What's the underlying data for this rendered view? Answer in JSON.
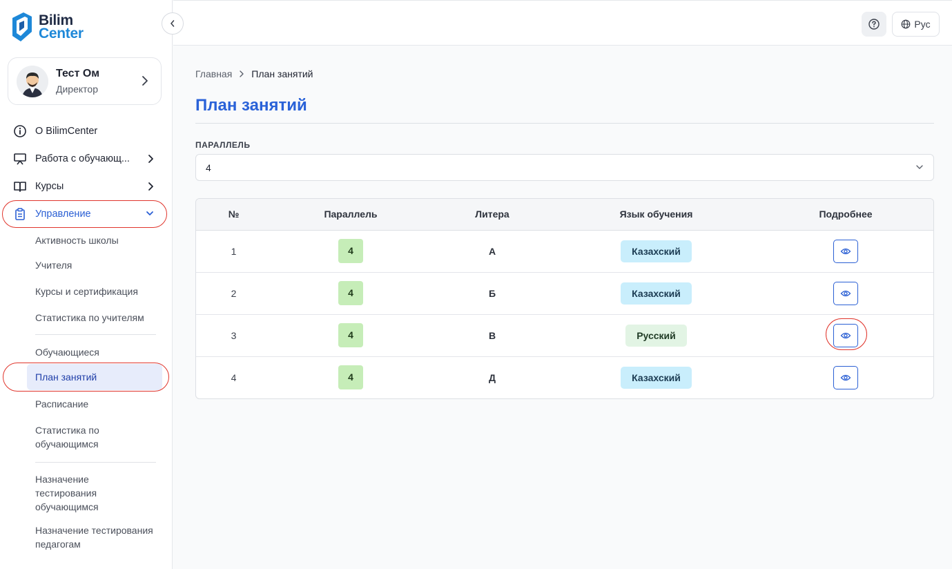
{
  "logo": {
    "line1": "Bilim",
    "line2": "Center"
  },
  "profile": {
    "name": "Тест Ом",
    "role": "Директор"
  },
  "nav": {
    "about": "О BilimCenter",
    "students_work": "Работа с обучающ...",
    "courses": "Курсы",
    "management": "Управление"
  },
  "submenu": {
    "activity": "Активность школы",
    "teachers": "Учителя",
    "courses_cert": "Курсы и сертификация",
    "teacher_stats": "Статистика по учителям",
    "students": "Обучающиеся",
    "lesson_plan": "План занятий",
    "schedule": "Расписание",
    "student_stats": "Статистика по обучающимся",
    "assign_student_tests": "Назначение тестирования обучающимся",
    "assign_teacher_tests": "Назначение тестирования педагогам"
  },
  "topbar": {
    "language": "Рус"
  },
  "breadcrumb": {
    "home": "Главная",
    "current": "План занятий"
  },
  "page": {
    "title": "План занятий"
  },
  "filter": {
    "label": "ПАРАЛЛЕЛЬ",
    "value": "4"
  },
  "table": {
    "headers": {
      "num": "№",
      "parallel": "Параллель",
      "litera": "Литера",
      "language": "Язык обучения",
      "details": "Подробнее"
    },
    "rows": [
      {
        "num": "1",
        "parallel": "4",
        "litera": "А",
        "language": "Казахский"
      },
      {
        "num": "2",
        "parallel": "4",
        "litera": "Б",
        "language": "Казахский"
      },
      {
        "num": "3",
        "parallel": "4",
        "litera": "В",
        "language": "Русский"
      },
      {
        "num": "4",
        "parallel": "4",
        "litera": "Д",
        "language": "Казахский"
      }
    ]
  },
  "colors": {
    "accent": "#2a62d8",
    "highlight_ring": "#e0342b",
    "badge_green": "#c6edb8",
    "badge_blue": "#c9eefc",
    "badge_ru": "#e2f4e4"
  },
  "icons": [
    "info-icon",
    "presentation-icon",
    "book-icon",
    "clipboard-icon",
    "chevron-right-icon",
    "chevron-down-icon",
    "chevron-left-icon",
    "help-icon",
    "globe-icon",
    "eye-icon"
  ]
}
